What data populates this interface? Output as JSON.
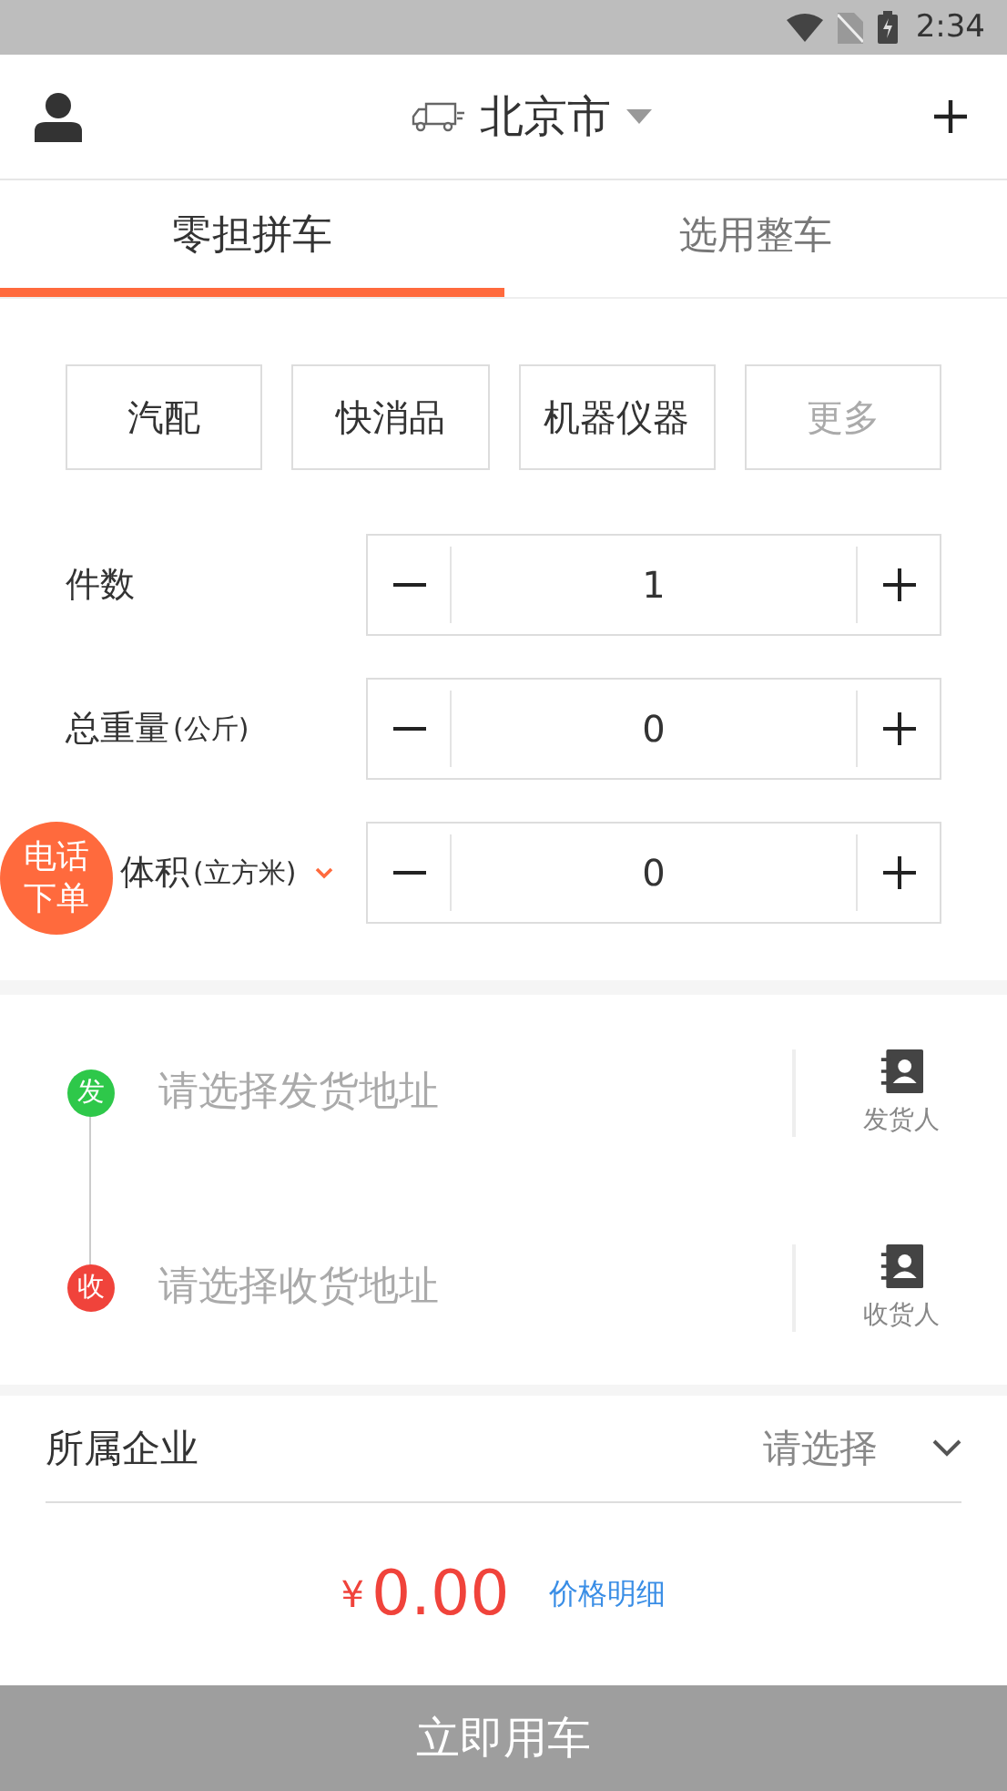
{
  "status_bar": {
    "time": "2:34"
  },
  "header": {
    "city": "北京市"
  },
  "tabs": [
    {
      "label": "零担拼车",
      "selected": true
    },
    {
      "label": "选用整车",
      "selected": false
    }
  ],
  "categories": [
    {
      "label": "汽配",
      "kind": "category"
    },
    {
      "label": "快消品",
      "kind": "category"
    },
    {
      "label": "机器仪器",
      "kind": "category"
    },
    {
      "label": "更多",
      "kind": "more"
    }
  ],
  "quantities": [
    {
      "label": "件数",
      "value": "1"
    },
    {
      "label": "总重量",
      "unit": "(公斤)",
      "value": "0"
    },
    {
      "label": "体积",
      "unit": "(立方米)",
      "value": "0",
      "dropdown": true
    }
  ],
  "phone_order_button": {
    "line_1": "电话",
    "line_2": "下单"
  },
  "addresses": [
    {
      "badge": "发",
      "color": "#2ec84a",
      "placeholder": "请选择发货地址",
      "contact_label": "发货人"
    },
    {
      "badge": "收",
      "color": "#f0433b",
      "placeholder": "请选择收货地址",
      "contact_label": "收货人"
    }
  ],
  "company": {
    "label": "所属企业",
    "placeholder": "请选择"
  },
  "price": {
    "currency": "¥",
    "amount": "0.00",
    "details_link": "价格明细"
  },
  "submit_button": "立即用车"
}
